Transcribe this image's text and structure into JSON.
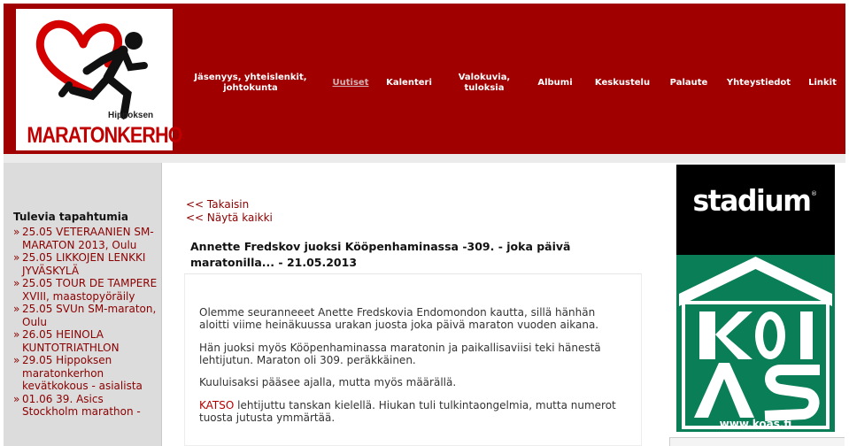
{
  "header": {
    "logo_sub": "Hippoksen",
    "logo_main": "MARATONKERHO",
    "nav": [
      "Jäsenyys, yhteislenkit, johtokunta",
      "Uutiset",
      "Kalenteri",
      "Valokuvia, tuloksia",
      "Albumi",
      "Keskustelu",
      "Palaute",
      "Yhteystiedot",
      "Linkit"
    ]
  },
  "sidebar": {
    "title": "Tulevia tapahtumia",
    "bullet": "»",
    "events": [
      "25.05 VETERAANIEN SM-MARATON 2013, Oulu",
      "25.05 LIKKOJEN LENKKI JYVÄSKYLÄ",
      "25.05 TOUR DE TAMPERE XVIII, maastopyöräily",
      "25.05 SVUn SM-maraton, Oulu",
      "26.05 HEINOLA KUNTOTRIATHLON",
      "29.05 Hippoksen maratonkerhon kevätkokous - asialista",
      "01.06 39. Asics Stockholm marathon -"
    ]
  },
  "main": {
    "back_link": "<< Takaisin",
    "show_all_link": "<< Näytä kaikki",
    "title": "Annette Fredskov juoksi Kööpenhaminassa -309. - joka päivä maratonilla... - 21.05.2013",
    "paragraphs": [
      "Olemme seuranneeet Anette Fredskovia Endomondon kautta, sillä hänhän aloitti viime heinäkuussa urakan juosta joka päivä maraton vuoden aikana.",
      "Hän juoksi myös Kööpenhaminassa maratonin ja paikallisaviisi teki hänestä lehtijutun. Maraton oli 309. peräkkäinen.",
      "Kuuluisaksi pääsee ajalla, mutta myös määrällä."
    ],
    "katso_link": "KATSO",
    "last_paragraph": " lehtijuttu tanskan kielellä. Hiukan tuli tulkintaongelmia, mutta numerot tuosta jutusta ymmärtää."
  },
  "ads": {
    "stadium_text": "stadium",
    "stadium_reg": "®",
    "koas_url": "www.koas.fi"
  },
  "colors": {
    "brand_red": "#a00000",
    "link_red": "#8b0000",
    "koas_green": "#0a7f57"
  }
}
